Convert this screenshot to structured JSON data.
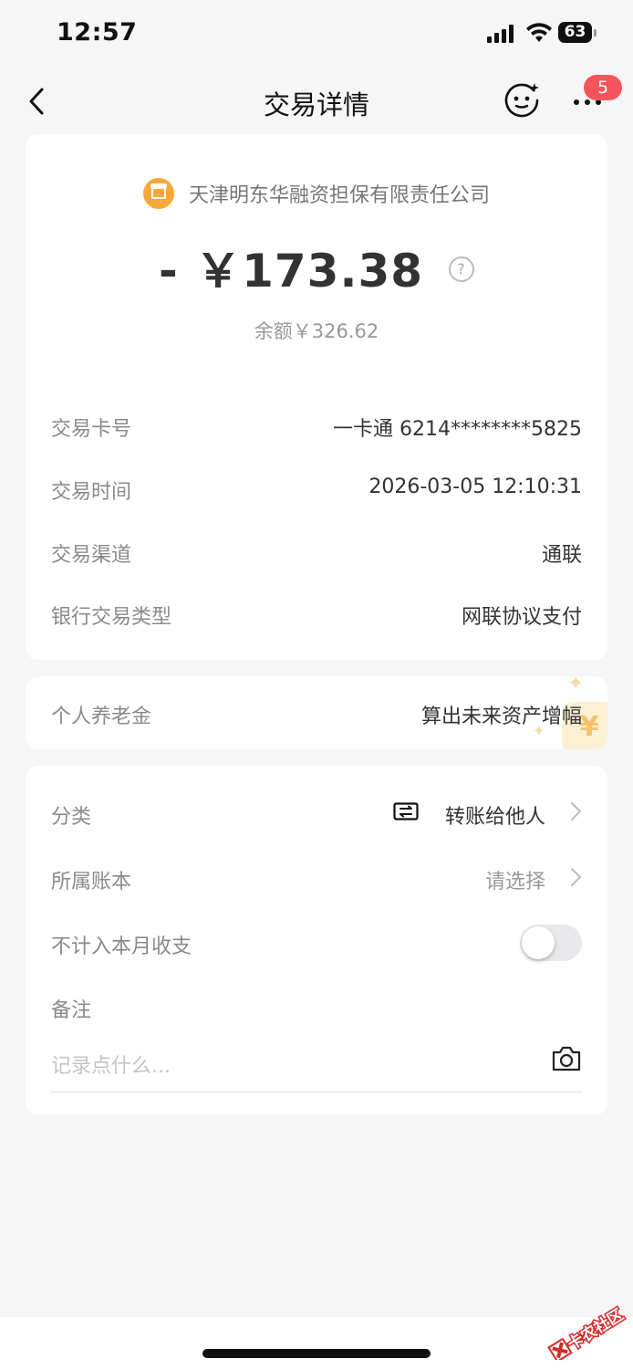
{
  "status_bar": {
    "time": "12:57",
    "battery": "63"
  },
  "nav": {
    "title": "交易详情",
    "badge_count": "5"
  },
  "summary": {
    "merchant": "天津明东华融资担保有限责任公司",
    "amount": "- ￥173.38",
    "balance": "余额￥326.62"
  },
  "details": [
    {
      "label": "交易卡号",
      "value": "一卡通 6214********5825"
    },
    {
      "label": "交易时间",
      "value": "2026-03-05 12:10:31"
    },
    {
      "label": "交易渠道",
      "value": "通联"
    },
    {
      "label": "银行交易类型",
      "value": "网联协议支付"
    }
  ],
  "pension": {
    "label": "个人养老金",
    "value": "算出未来资产增幅"
  },
  "settings": {
    "category_label": "分类",
    "category_value": "转账给他人",
    "account_book_label": "所属账本",
    "account_book_value": "请选择",
    "exclude_label": "不计入本月收支",
    "exclude_enabled": false,
    "note_label": "备注",
    "note_placeholder": "记录点什么..."
  },
  "watermark": "卡农社区",
  "colors": {
    "background": "#f6f6f6",
    "badge": "#f5555a",
    "merchant_icon": "#f7a839",
    "card": "#ffffff"
  }
}
